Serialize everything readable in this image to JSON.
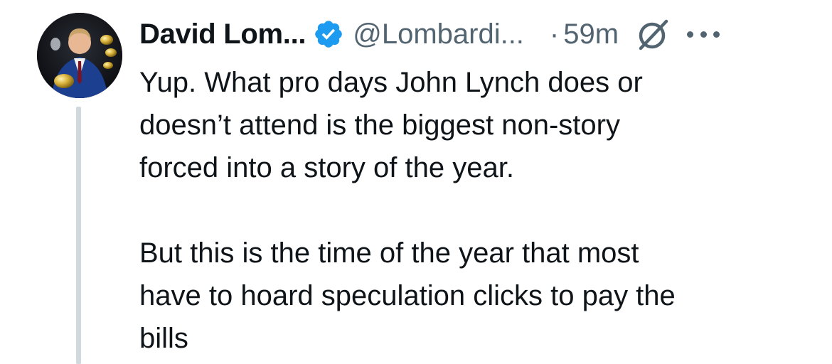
{
  "author": {
    "display_name": "David Lom...",
    "handle": "@Lombardi...",
    "verified": true,
    "verified_color": "#1d9bf0",
    "avatar_icon": "profile-photo"
  },
  "meta": {
    "separator": "·",
    "timestamp": "59m",
    "grok_icon": "grok-icon",
    "more_icon": "more-icon"
  },
  "tweet": {
    "paragraphs": [
      [
        "Yup. What pro days John Lynch does or",
        "doesn’t attend is the biggest non-story",
        "forced into a story of the year."
      ],
      [
        "But this is the time of the year that most",
        "have to hoard speculation clicks to pay the",
        "bills"
      ]
    ]
  },
  "colors": {
    "text": "#0f1419",
    "secondary": "#536471",
    "thread_line": "#cfd9de"
  }
}
